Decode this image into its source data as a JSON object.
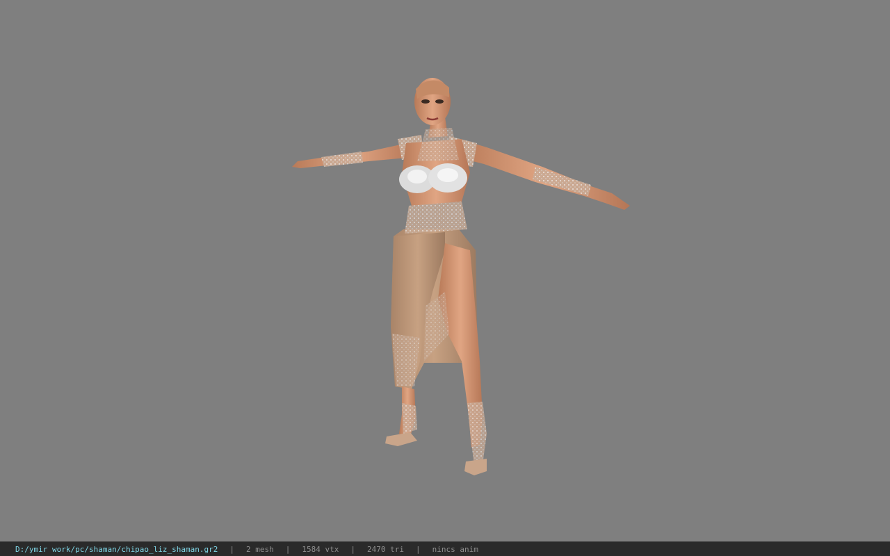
{
  "viewport": {
    "background_color": "#7f7f7f",
    "model_icon": "character-model-tpose"
  },
  "statusbar": {
    "file_path": "D:/ymir work/pc/shaman/chipao_liz_shaman.gr2",
    "separator": "|",
    "mesh_count": "2 mesh",
    "vertex_count": "1584 vtx",
    "triangle_count": "2470 tri",
    "animation": "nincs anim",
    "path_color": "#7fd6e6",
    "stat_color": "#8f8f8f",
    "background_color": "#2a2a2a"
  }
}
